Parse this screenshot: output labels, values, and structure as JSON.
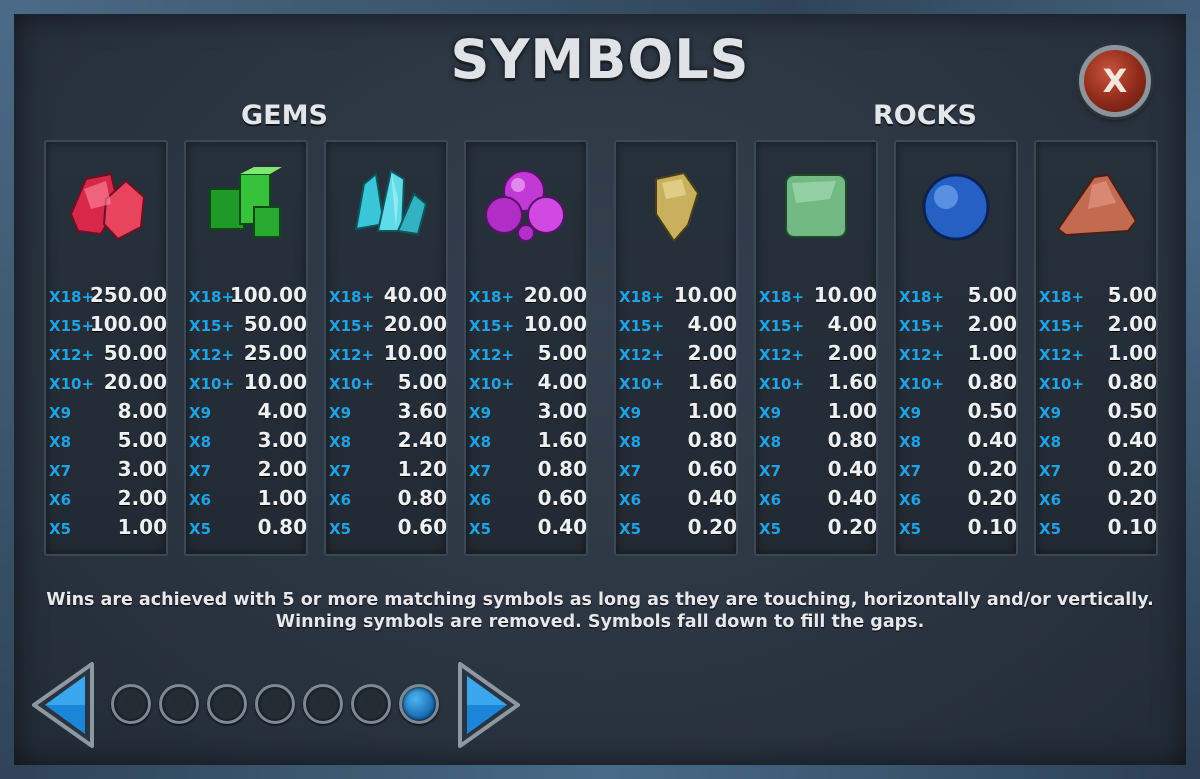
{
  "title": "SYMBOLS",
  "sections": {
    "gems": "GEMS",
    "rocks": "ROCKS"
  },
  "close_label": "X",
  "symbols": [
    {
      "name": "red-gem",
      "color": "#e23a55",
      "rows": [
        {
          "m": "X18+",
          "v": "250.00"
        },
        {
          "m": "X15+",
          "v": "100.00"
        },
        {
          "m": "X12+",
          "v": "50.00"
        },
        {
          "m": "X10+",
          "v": "20.00"
        },
        {
          "m": "X9",
          "v": "8.00"
        },
        {
          "m": "X8",
          "v": "5.00"
        },
        {
          "m": "X7",
          "v": "3.00"
        },
        {
          "m": "X6",
          "v": "2.00"
        },
        {
          "m": "X5",
          "v": "1.00"
        }
      ]
    },
    {
      "name": "green-gem",
      "color": "#3cc43a",
      "rows": [
        {
          "m": "X18+",
          "v": "100.00"
        },
        {
          "m": "X15+",
          "v": "50.00"
        },
        {
          "m": "X12+",
          "v": "25.00"
        },
        {
          "m": "X10+",
          "v": "10.00"
        },
        {
          "m": "X9",
          "v": "4.00"
        },
        {
          "m": "X8",
          "v": "3.00"
        },
        {
          "m": "X7",
          "v": "2.00"
        },
        {
          "m": "X6",
          "v": "1.00"
        },
        {
          "m": "X5",
          "v": "0.80"
        }
      ]
    },
    {
      "name": "cyan-crystal",
      "color": "#37c9d8",
      "rows": [
        {
          "m": "X18+",
          "v": "40.00"
        },
        {
          "m": "X15+",
          "v": "20.00"
        },
        {
          "m": "X12+",
          "v": "10.00"
        },
        {
          "m": "X10+",
          "v": "5.00"
        },
        {
          "m": "X9",
          "v": "3.60"
        },
        {
          "m": "X8",
          "v": "2.40"
        },
        {
          "m": "X7",
          "v": "1.20"
        },
        {
          "m": "X6",
          "v": "0.80"
        },
        {
          "m": "X5",
          "v": "0.60"
        }
      ]
    },
    {
      "name": "purple-gem",
      "color": "#c13bd6",
      "rows": [
        {
          "m": "X18+",
          "v": "20.00"
        },
        {
          "m": "X15+",
          "v": "10.00"
        },
        {
          "m": "X12+",
          "v": "5.00"
        },
        {
          "m": "X10+",
          "v": "4.00"
        },
        {
          "m": "X9",
          "v": "3.00"
        },
        {
          "m": "X8",
          "v": "1.60"
        },
        {
          "m": "X7",
          "v": "0.80"
        },
        {
          "m": "X6",
          "v": "0.60"
        },
        {
          "m": "X5",
          "v": "0.40"
        }
      ]
    },
    {
      "name": "yellow-rock",
      "color": "#c9b15e",
      "rows": [
        {
          "m": "X18+",
          "v": "10.00"
        },
        {
          "m": "X15+",
          "v": "4.00"
        },
        {
          "m": "X12+",
          "v": "2.00"
        },
        {
          "m": "X10+",
          "v": "1.60"
        },
        {
          "m": "X9",
          "v": "1.00"
        },
        {
          "m": "X8",
          "v": "0.80"
        },
        {
          "m": "X7",
          "v": "0.60"
        },
        {
          "m": "X6",
          "v": "0.40"
        },
        {
          "m": "X5",
          "v": "0.20"
        }
      ]
    },
    {
      "name": "green-rock",
      "color": "#7fc590",
      "rows": [
        {
          "m": "X18+",
          "v": "10.00"
        },
        {
          "m": "X15+",
          "v": "4.00"
        },
        {
          "m": "X12+",
          "v": "2.00"
        },
        {
          "m": "X10+",
          "v": "1.60"
        },
        {
          "m": "X9",
          "v": "1.00"
        },
        {
          "m": "X8",
          "v": "0.80"
        },
        {
          "m": "X7",
          "v": "0.40"
        },
        {
          "m": "X6",
          "v": "0.40"
        },
        {
          "m": "X5",
          "v": "0.20"
        }
      ]
    },
    {
      "name": "blue-rock",
      "color": "#2f6fd0",
      "rows": [
        {
          "m": "X18+",
          "v": "5.00"
        },
        {
          "m": "X15+",
          "v": "2.00"
        },
        {
          "m": "X12+",
          "v": "1.00"
        },
        {
          "m": "X10+",
          "v": "0.80"
        },
        {
          "m": "X9",
          "v": "0.50"
        },
        {
          "m": "X8",
          "v": "0.40"
        },
        {
          "m": "X7",
          "v": "0.20"
        },
        {
          "m": "X6",
          "v": "0.20"
        },
        {
          "m": "X5",
          "v": "0.10"
        }
      ]
    },
    {
      "name": "orange-rock",
      "color": "#c8735a",
      "rows": [
        {
          "m": "X18+",
          "v": "5.00"
        },
        {
          "m": "X15+",
          "v": "2.00"
        },
        {
          "m": "X12+",
          "v": "1.00"
        },
        {
          "m": "X10+",
          "v": "0.80"
        },
        {
          "m": "X9",
          "v": "0.50"
        },
        {
          "m": "X8",
          "v": "0.40"
        },
        {
          "m": "X7",
          "v": "0.20"
        },
        {
          "m": "X6",
          "v": "0.20"
        },
        {
          "m": "X5",
          "v": "0.10"
        }
      ]
    }
  ],
  "description": {
    "line1": "Wins are achieved with 5 or more matching symbols as long as they are touching, horizontally and/or vertically.",
    "line2": "Winning symbols are removed. Symbols fall down to fill the gaps."
  },
  "pagination": {
    "pages": 7,
    "current": 7
  },
  "colors": {
    "multiplier": "#1fa3e6",
    "accent_blue": "#1b86d8"
  }
}
